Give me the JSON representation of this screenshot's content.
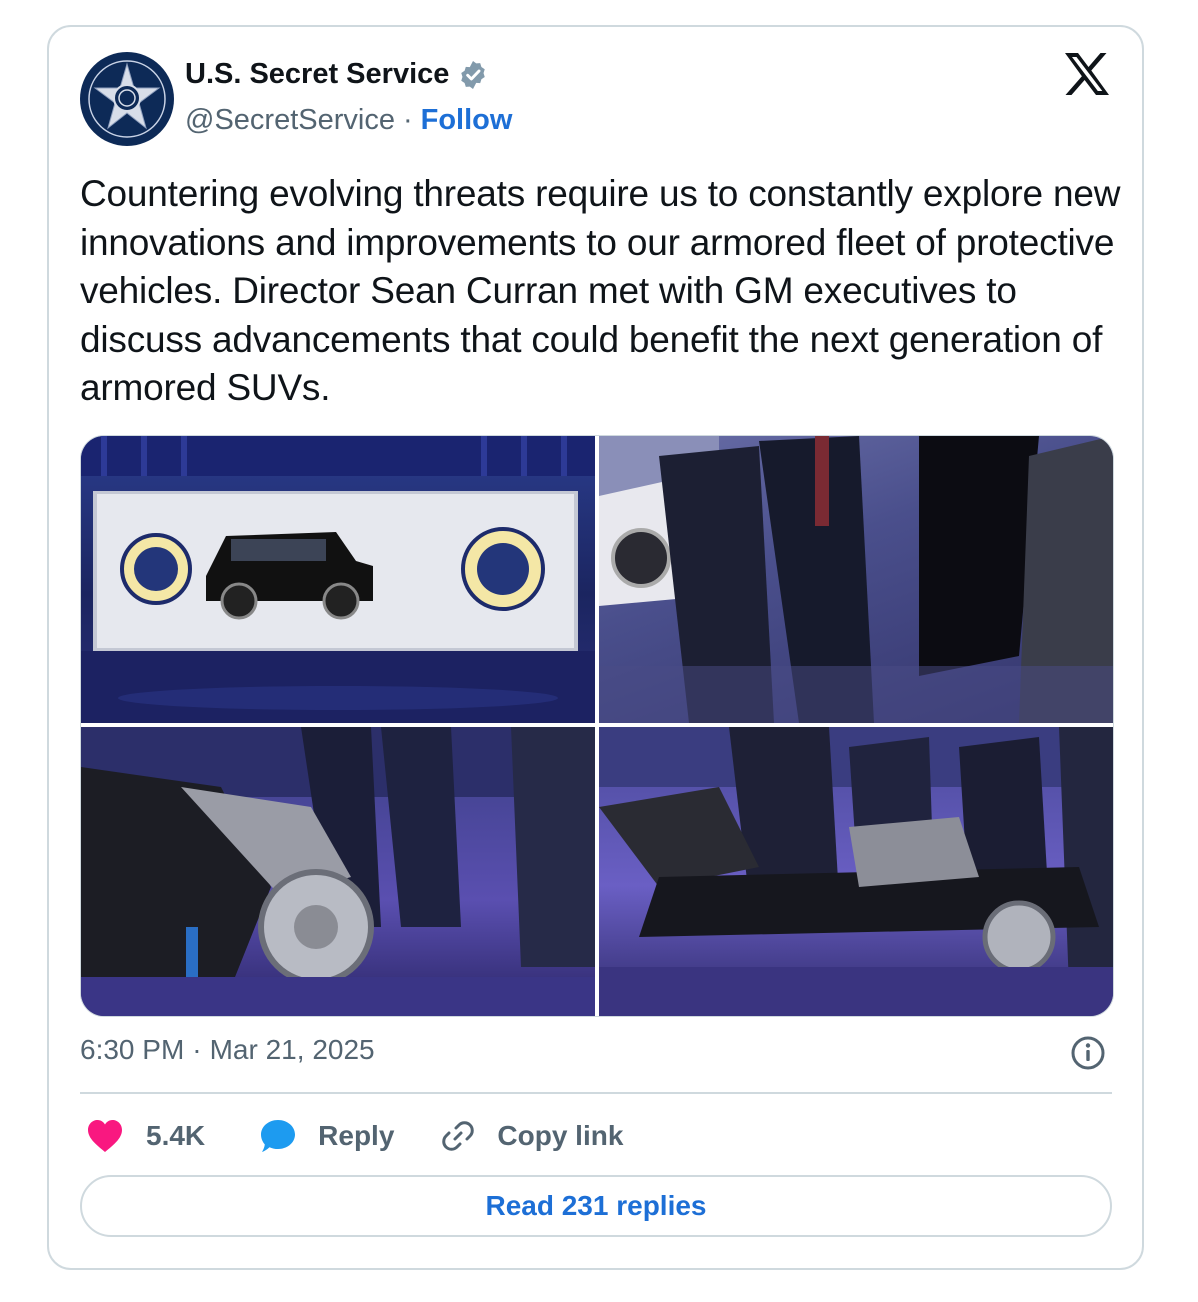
{
  "author": {
    "name": "U.S. Secret Service",
    "handle": "@SecretService",
    "separator": "·",
    "follow_label": "Follow",
    "avatar_icon": "secret-service-star-badge",
    "verified_icon": "verified-badge"
  },
  "platform_logo": "x-logo",
  "tweet": {
    "text": "Countering evolving threats require us to constantly explore new innovations and improvements to our armored fleet of protective vehicles. Director Sean Curran met with GM executives to discuss advancements that could benefit the next generation of armored SUVs.",
    "photos": [
      {
        "description": "Armored black SUV on display screen between presidential seals"
      },
      {
        "description": "Men in suits standing beside an open armored vehicle door"
      },
      {
        "description": "Vehicle chassis with suspension and brake rotor, men standing behind"
      },
      {
        "description": "Armored vehicle chassis frame with group of men in suits"
      }
    ]
  },
  "meta": {
    "time": "6:30 PM",
    "separator": "·",
    "date": "Mar 21, 2025",
    "info_icon": "info-icon"
  },
  "actions": {
    "like_count": "5.4K",
    "reply_label": "Reply",
    "copy_label": "Copy link"
  },
  "read_replies_label": "Read 231 replies",
  "colors": {
    "accent": "#1d6fd6",
    "like": "#f91880",
    "reply_icon": "#1d9bf0",
    "muted": "#536471",
    "border": "#cfd9de"
  }
}
